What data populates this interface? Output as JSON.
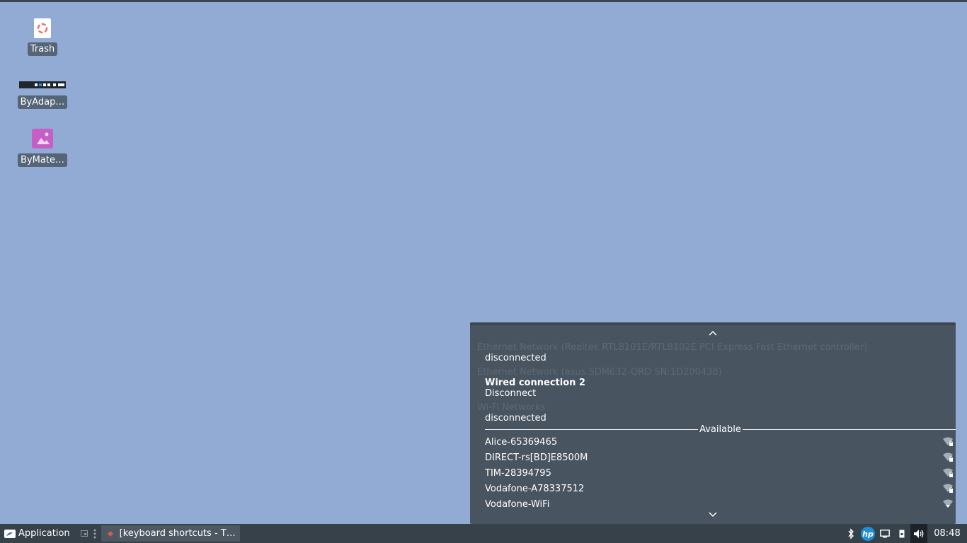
{
  "desktop": {
    "icons": [
      {
        "label": "Trash",
        "icon": "trash-icon"
      },
      {
        "label": "ByAdap…",
        "icon": "screenshot-thumbnail"
      },
      {
        "label": "ByMate…",
        "icon": "image-file-icon"
      }
    ]
  },
  "network_menu": {
    "scroll_up": "⌃",
    "sections": [
      {
        "header": "Ethernet Network (Realtek RTL8101E/RTL8102E PCI Express Fast Ethernet controller)",
        "status": "disconnected"
      },
      {
        "header": "Ethernet Network (asus SDM632-QRD SN:1D200438)",
        "connection": "Wired connection 2",
        "action": "Disconnect"
      },
      {
        "header": "Wi-Fi Networks",
        "status": "disconnected"
      }
    ],
    "available_label": "Available",
    "wifi_networks": [
      {
        "ssid": "Alice-65369465",
        "secured": true
      },
      {
        "ssid": "DIRECT-rs[BD]E8500M",
        "secured": true
      },
      {
        "ssid": "TIM-28394795",
        "secured": true
      },
      {
        "ssid": "Vodafone-A78337512",
        "secured": true
      },
      {
        "ssid": "Vodafone-WiFi",
        "secured": false
      }
    ],
    "scroll_down": "⌄"
  },
  "taskbar": {
    "app_menu_label": "Application",
    "task_title": "[keyboard shortcuts - T…",
    "tray_icons": [
      "bluetooth-icon",
      "hp-icon",
      "display-icon",
      "usb-drive-icon",
      "volume-icon"
    ],
    "clock": "08:48"
  },
  "colors": {
    "desktop_bg": "#91abd4",
    "panel_bg": "#37414a",
    "menu_bg": "#485460",
    "menu_header": "#5c6a76",
    "hp_blue": "#1f8fd6"
  }
}
